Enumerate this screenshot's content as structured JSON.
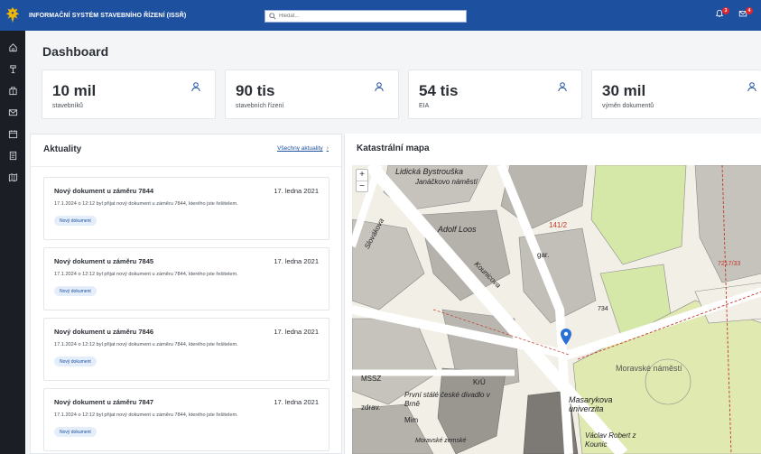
{
  "app": {
    "title": "INFORMAČNÍ SYSTÉM STAVEBNÍHO ŘÍZENÍ (ISSŘ)"
  },
  "search": {
    "placeholder": "Hledat..."
  },
  "header": {
    "notifications": {
      "icon": "bell-icon",
      "count": "3"
    },
    "messages": {
      "icon": "mail-icon",
      "count": "4"
    }
  },
  "sidebar": {
    "items": [
      {
        "icon": "home-icon"
      },
      {
        "icon": "hammer-icon"
      },
      {
        "icon": "building-icon"
      },
      {
        "icon": "mail-icon"
      },
      {
        "icon": "calendar-icon"
      },
      {
        "icon": "document-icon"
      },
      {
        "icon": "map-icon"
      }
    ]
  },
  "dashboard": {
    "title": "Dashboard",
    "stats": [
      {
        "value": "10 mil",
        "label": "stavebníků",
        "icon": "person-icon"
      },
      {
        "value": "90 tis",
        "label": "stavebních řízení",
        "icon": "person-icon"
      },
      {
        "value": "54 tis",
        "label": "EIA",
        "icon": "person-icon"
      },
      {
        "value": "30 mil",
        "label": "výměn dokumentů",
        "icon": "person-icon"
      }
    ]
  },
  "news": {
    "title": "Aktuality",
    "all_link": "Všechny aktuality",
    "items": [
      {
        "title": "Nový dokument u záměru 7844",
        "date": "17. ledna 2021",
        "desc": "17.1.2024 o 12:12 byl přijat nový dokument u záměru 7844, kterého jste řešitelem.",
        "tag": "Nový dokument"
      },
      {
        "title": "Nový dokument u záměru 7845",
        "date": "17. ledna 2021",
        "desc": "17.1.2024 o 12:12 byl přijat nový dokument u záměru 7844, kterého jste řešitelem.",
        "tag": "Nový dokument"
      },
      {
        "title": "Nový dokument u záměru 7846",
        "date": "17. ledna 2021",
        "desc": "17.1.2024 o 12:12 byl přijat nový dokument u záměru 7844, kterého jste řešitelem.",
        "tag": "Nový dokument"
      },
      {
        "title": "Nový dokument u záměru 7847",
        "date": "17. ledna 2021",
        "desc": "17.1.2024 o 12:12 byl přijat nový dokument u záměru 7844, kterého jste řešitelem.",
        "tag": "Nový dokument"
      }
    ]
  },
  "map": {
    "title": "Katastrální mapa",
    "zoom_in": "+",
    "zoom_out": "−",
    "labels": {
      "street1": "Lidická Bystrouška",
      "street2": "Janáčkovo náměstí",
      "street3": "Slovákova",
      "street4": "Adolf Loos",
      "street5": "Kounicova",
      "street6": "Moravské náměstí",
      "street7": "Masarykova univerzita",
      "street8": "První stálé české divadlo v Brně",
      "street9": "Václav Robert z Kounic",
      "street10": "Moravské zemské",
      "place1": "gar.",
      "place2": "KrÚ",
      "place3": "MSSZ",
      "place4": "zdrav.",
      "place5": "Mim",
      "parcel1": "141/2",
      "parcel2": "7217/33",
      "parcel3": "734"
    }
  },
  "colors": {
    "brand": "#1e50a0",
    "sidebar": "#1b1f25",
    "badge": "#e0262d",
    "tag_bg": "#e4eefb"
  }
}
